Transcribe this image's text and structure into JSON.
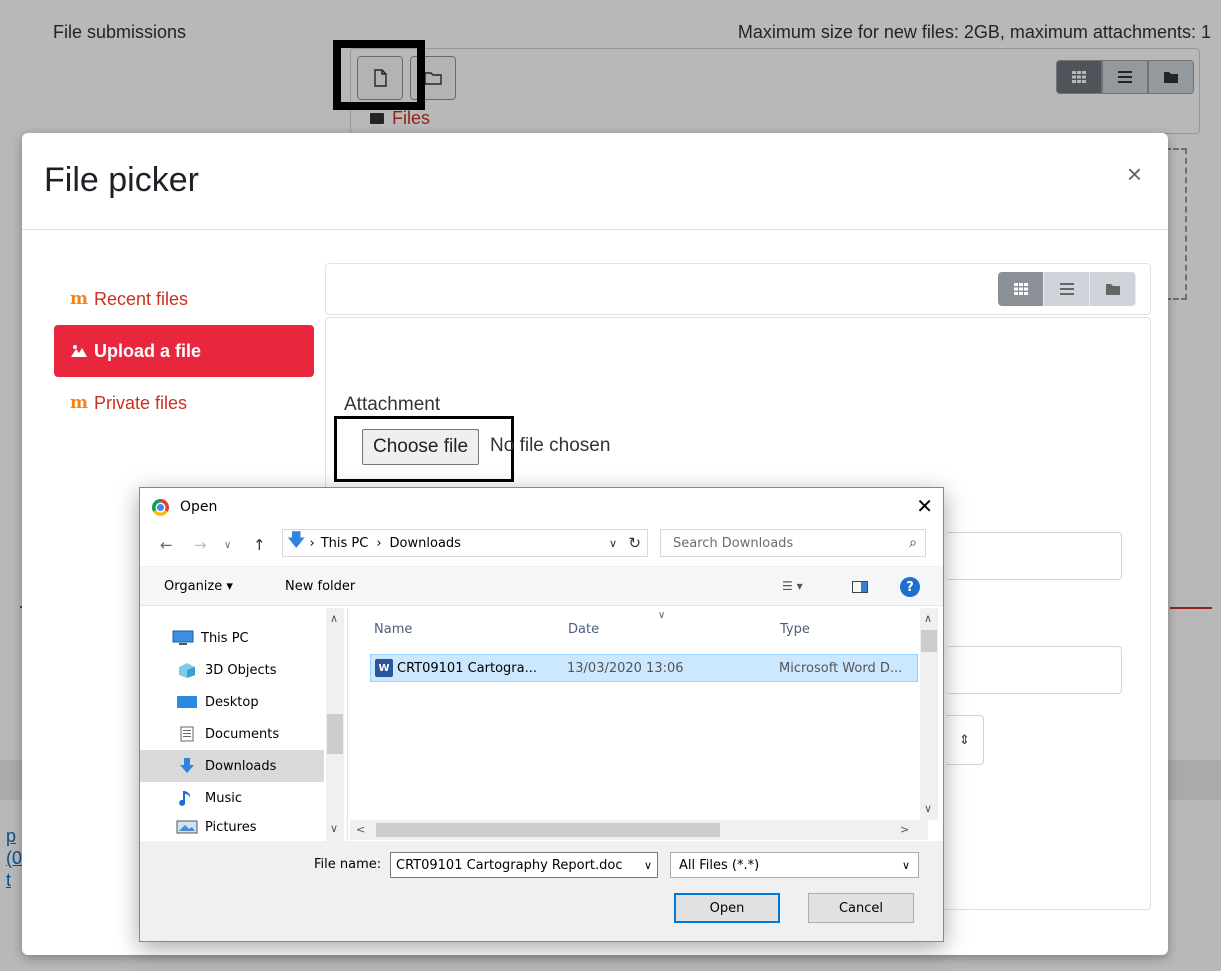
{
  "background": {
    "section_label": "File submissions",
    "limits_text": "Maximum size for new files: 2GB, maximum attachments: 1",
    "files_label": "Files",
    "side_links": [
      "p",
      "(0",
      "t"
    ]
  },
  "modal": {
    "title": "File picker",
    "close": "×",
    "nav": [
      {
        "label": "Recent files"
      },
      {
        "label": "Upload a file"
      },
      {
        "label": "Private files"
      }
    ],
    "attachment_label": "Attachment",
    "choose_button": "Choose file",
    "no_file_text": "No file chosen",
    "select_arrow": "⇕"
  },
  "open_dialog": {
    "title": "Open",
    "close": "✕",
    "address": {
      "this_pc": "This PC",
      "downloads": "Downloads",
      "sep": "›"
    },
    "search_placeholder": "Search Downloads",
    "toolbar": {
      "organize": "Organize ▾",
      "new_folder": "New folder",
      "help": "?"
    },
    "tree": [
      {
        "label": "This PC",
        "icon": "monitor-icon"
      },
      {
        "label": "3D Objects",
        "icon": "cube-icon"
      },
      {
        "label": "Desktop",
        "icon": "desktop-icon"
      },
      {
        "label": "Documents",
        "icon": "documents-icon"
      },
      {
        "label": "Downloads",
        "icon": "download-icon"
      },
      {
        "label": "Music",
        "icon": "music-icon"
      },
      {
        "label": "Pictures",
        "icon": "pictures-icon"
      }
    ],
    "columns": {
      "name": "Name",
      "date": "Date",
      "type": "Type"
    },
    "files": [
      {
        "name": "CRT09101 Cartogra...",
        "date": "13/03/2020 13:06",
        "type": "Microsoft Word D..."
      }
    ],
    "file_name_label": "File name:",
    "file_name_value": "CRT09101 Cartography Report.doc",
    "file_type_value": "All Files (*.*)",
    "open_button": "Open",
    "cancel_button": "Cancel"
  }
}
